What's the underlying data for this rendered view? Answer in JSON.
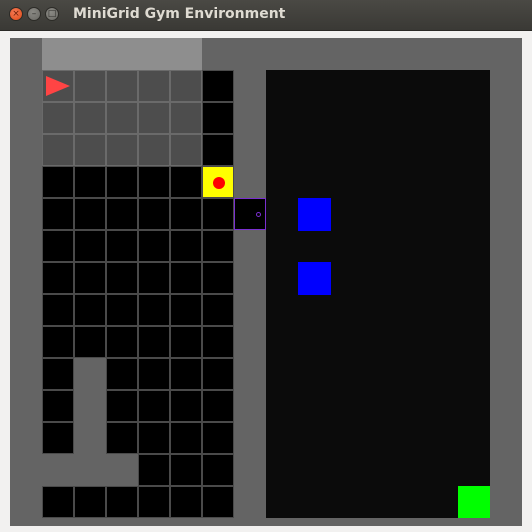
{
  "window": {
    "title": "MiniGrid Gym Environment",
    "buttons": [
      {
        "name": "close-button",
        "glyph": "×"
      },
      {
        "name": "minimize-button",
        "glyph": "–"
      },
      {
        "name": "maximize-button",
        "glyph": "□"
      }
    ]
  },
  "grid": {
    "cols": 16,
    "rows": 15,
    "colors": {
      "wall": "#646464",
      "floor": "#000000",
      "floor_highlight": "#4d4d4d",
      "wall_highlight": "#8e8e8e",
      "agent": "#ff4444",
      "key_tile": "#ffff00",
      "ball": "#ff0000",
      "door": "#7a2fd0",
      "box": "#0000ff",
      "goal": "#00ff00"
    },
    "agent": {
      "icon": "triangle-right-icon",
      "direction": "right",
      "col": 1,
      "row": 1
    },
    "objects": [
      {
        "type": "yellow-square",
        "col": 6,
        "row": 4
      },
      {
        "type": "red-ball",
        "col": 6,
        "row": 4
      },
      {
        "type": "purple-door",
        "col": 7,
        "row": 5
      },
      {
        "type": "blue-box",
        "col": 9,
        "row": 5
      },
      {
        "type": "blue-box",
        "col": 9,
        "row": 7
      },
      {
        "type": "green-goal",
        "col": 14,
        "row": 14
      }
    ]
  }
}
